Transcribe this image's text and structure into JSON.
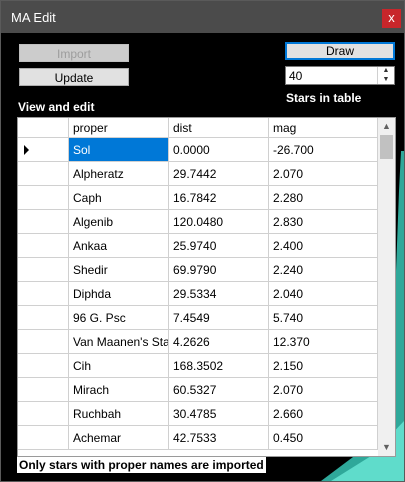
{
  "window": {
    "title": "MA Edit",
    "close_glyph": "x"
  },
  "buttons": {
    "import": "Import",
    "update": "Update",
    "draw": "Draw"
  },
  "labels": {
    "view_edit": "View and edit",
    "stars_in_table": "Stars in table",
    "footer": "Only stars with proper names are imported"
  },
  "spinner": {
    "value": "40"
  },
  "table": {
    "columns": [
      "proper",
      "dist",
      "mag"
    ],
    "current_row_marker": "right-triangle-icon",
    "rows": [
      [
        "Sol",
        "0.0000",
        "-26.700"
      ],
      [
        "Alpheratz",
        "29.7442",
        "2.070"
      ],
      [
        "Caph",
        "16.7842",
        "2.280"
      ],
      [
        "Algenib",
        "120.0480",
        "2.830"
      ],
      [
        "Ankaa",
        "25.9740",
        "2.400"
      ],
      [
        "Shedir",
        "69.9790",
        "2.240"
      ],
      [
        "Diphda",
        "29.5334",
        "2.040"
      ],
      [
        "96 G. Psc",
        "7.4549",
        "5.740"
      ],
      [
        "Van Maanen's Star",
        "4.2626",
        "12.370"
      ],
      [
        "Cih",
        "168.3502",
        "2.150"
      ],
      [
        "Mirach",
        "60.5327",
        "2.070"
      ],
      [
        "Ruchbah",
        "30.4785",
        "2.660"
      ],
      [
        "Achemar",
        "42.7533",
        "0.450"
      ]
    ]
  },
  "colors": {
    "selection": "#0078d7",
    "close": "#c8262b",
    "titlebar": "#4b4b4b",
    "background_accent": "#3fbfb0"
  }
}
